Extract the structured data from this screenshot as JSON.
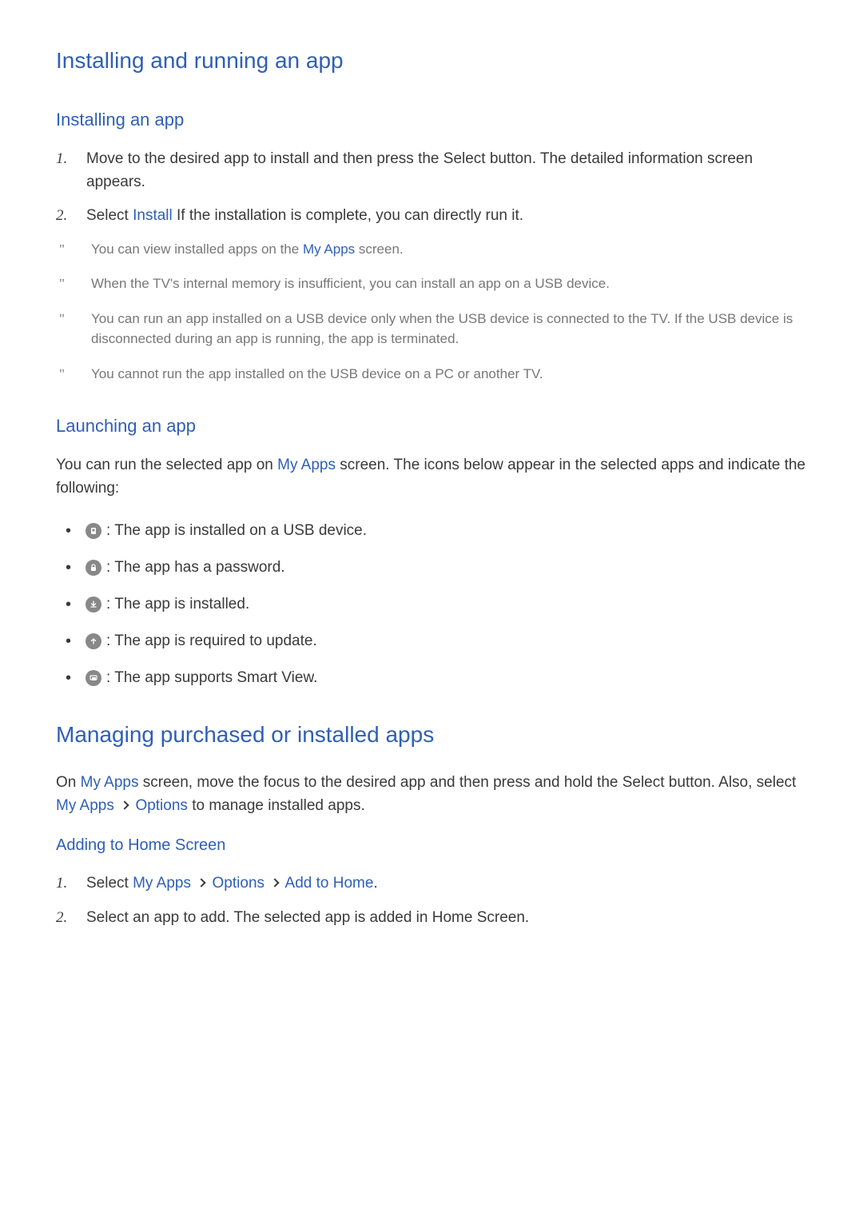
{
  "h1": "Installing and running an app",
  "installing": {
    "heading": "Installing an app",
    "steps": [
      {
        "num": "1.",
        "prefix": "",
        "text": "Move to the desired app to install and then press the Select button. The detailed information screen appears."
      },
      {
        "num": "2.",
        "prefix": "Select ",
        "link": "Install",
        "suffix": " If the installation is complete, you can directly run it."
      }
    ],
    "notes": [
      {
        "prefix": "You can view installed apps on the ",
        "link": "My Apps",
        "suffix": " screen."
      },
      {
        "prefix": "When the TV's internal memory is insufficient, you can install an app on a USB device.",
        "link": "",
        "suffix": ""
      },
      {
        "prefix": "You can run an app installed on a USB device only when the USB device is connected to the TV. If the USB device is disconnected during an app is running, the app is terminated.",
        "link": "",
        "suffix": ""
      },
      {
        "prefix": "You cannot run the app installed on the USB device on a PC or another TV.",
        "link": "",
        "suffix": ""
      }
    ]
  },
  "launching": {
    "heading": "Launching an app",
    "intro_prefix": "You can run the selected app on ",
    "intro_link": "My Apps",
    "intro_suffix": " screen. The icons below appear in the selected apps and indicate the following:",
    "items": [
      {
        "icon": "usb",
        "text": " : The app is installed on a USB device."
      },
      {
        "icon": "lock",
        "text": " : The app has a password."
      },
      {
        "icon": "check",
        "text": " : The app is installed."
      },
      {
        "icon": "up",
        "text": " : The app is required to update."
      },
      {
        "icon": "mirror",
        "text": " : The app supports Smart View."
      }
    ]
  },
  "managing": {
    "heading": "Managing purchased or installed apps",
    "para1_prefix": "On ",
    "para1_link1": "My Apps",
    "para1_mid": " screen, move the focus to the desired app and then press and hold the Select button. Also, select ",
    "para1_link2": "My Apps",
    "para1_link3": "Options",
    "para1_suffix": " to manage installed apps.",
    "adding": {
      "heading": "Adding to Home Screen",
      "step1_prefix": "Select ",
      "step1_link1": "My Apps",
      "step1_link2": "Options",
      "step1_link3": "Add to Home",
      "step1_suffix": ".",
      "step2": "Select an app to add. The selected app is added in Home Screen."
    }
  }
}
